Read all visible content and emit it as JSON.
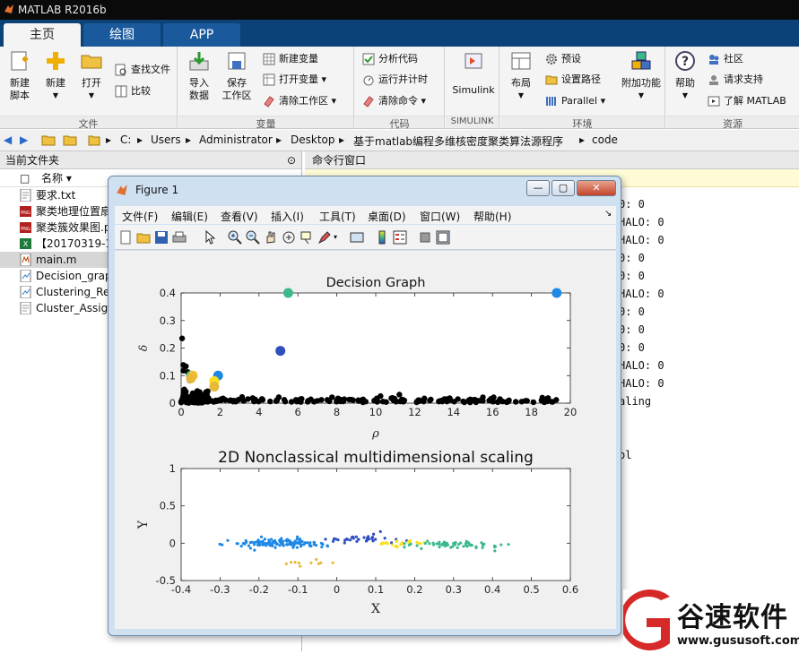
{
  "window": {
    "title": "MATLAB R2016b"
  },
  "tabs": [
    {
      "label": "主页",
      "active": true
    },
    {
      "label": "绘图",
      "active": false
    },
    {
      "label": "APP",
      "active": false
    }
  ],
  "ribbon": {
    "groups": {
      "file": "文件",
      "variable": "变量",
      "code": "代码",
      "simulink": "SIMULINK",
      "env": "环境",
      "resource": "资源"
    },
    "new_script": [
      "新建",
      "脚本"
    ],
    "new": "新建",
    "open": "打开",
    "find_files": "查找文件",
    "compare": "比较",
    "import_data": [
      "导入",
      "数据"
    ],
    "save_ws": [
      "保存",
      "工作区"
    ],
    "new_var": "新建变量",
    "open_var": "打开变量",
    "clear_ws": "清除工作区",
    "analyze": "分析代码",
    "run_time": "运行并计时",
    "clear_cmd": "清除命令",
    "simulink": "Simulink",
    "layout": "布局",
    "prefs": "预设",
    "set_path": "设置路径",
    "parallel": "Parallel",
    "addons": "附加功能",
    "help": "帮助",
    "community": "社区",
    "support": "请求支持",
    "learn": "了解 MATLAB"
  },
  "address": [
    "C:",
    "Users",
    "Administrator",
    "Desktop",
    "基于matlab编程多维核密度聚类算法源程序",
    "code"
  ],
  "left_pane": {
    "title": "当前文件夹",
    "col_name": "名称",
    "files": [
      {
        "name": "要求.txt",
        "icon": "txt-file-icon",
        "selected": false
      },
      {
        "name": "聚类地理位置扇",
        "icon": "png-file-icon",
        "selected": false
      },
      {
        "name": "聚类簇效果图.p",
        "icon": "png-file-icon",
        "selected": false
      },
      {
        "name": "【20170319-1",
        "icon": "excel-file-icon",
        "selected": false
      },
      {
        "name": "main.m",
        "icon": "m-file-icon",
        "selected": true
      },
      {
        "name": "Decision_grap",
        "icon": "fig-file-icon",
        "selected": false
      },
      {
        "name": "Clustering_Re",
        "icon": "fig-file-icon",
        "selected": false
      },
      {
        "name": "Cluster_Assigr",
        "icon": "txt-file-icon",
        "selected": false
      }
    ]
  },
  "command_window": {
    "title": "命令行窗口",
    "lines": [
      "0: 0",
      "HALO: 0",
      "HALO: 0",
      "0: 0",
      "0: 0",
      "HALO: 0",
      "0: 0",
      "0: 0",
      "0: 0",
      "HALO: 0",
      "HALO: 0",
      "aling",
      "",
      "",
      "ol"
    ]
  },
  "figure": {
    "title": "Figure 1",
    "menu": [
      "文件(F)",
      "编辑(E)",
      "查看(V)",
      "插入(I)",
      "工具(T)",
      "桌面(D)",
      "窗口(W)",
      "帮助(H)"
    ]
  },
  "chart_data": [
    {
      "type": "scatter",
      "title": "Decision Graph",
      "xlabel": "ρ",
      "ylabel": "δ",
      "xlim": [
        0,
        20
      ],
      "ylim": [
        0,
        0.4
      ],
      "xticks": [
        0,
        2,
        4,
        6,
        8,
        10,
        12,
        14,
        16,
        18,
        20
      ],
      "yticks": [
        0,
        0.1,
        0.2,
        0.3,
        0.4
      ],
      "highlighted": [
        {
          "x": 5.5,
          "y": 0.4,
          "color": "#3cb98a"
        },
        {
          "x": 19.3,
          "y": 0.4,
          "color": "#1e88e5"
        },
        {
          "x": 5.1,
          "y": 0.19,
          "color": "#2f4fbf"
        },
        {
          "x": 1.9,
          "y": 0.1,
          "color": "#1e88e5"
        },
        {
          "x": 0.5,
          "y": 0.1,
          "color": "#3cb98a"
        },
        {
          "x": 0.6,
          "y": 0.1,
          "color": "#f0c030"
        },
        {
          "x": 0.5,
          "y": 0.09,
          "color": "#e8b83a"
        },
        {
          "x": 1.7,
          "y": 0.08,
          "color": "#f8e020"
        },
        {
          "x": 1.7,
          "y": 0.06,
          "color": "#e8b83a"
        }
      ],
      "point_color": "#000000"
    },
    {
      "type": "scatter",
      "title": "2D Nonclassical multidimensional scaling",
      "xlabel": "X",
      "ylabel": "Y",
      "xlim": [
        -0.4,
        0.6
      ],
      "ylim": [
        -0.5,
        1
      ],
      "xticks": [
        -0.4,
        -0.3,
        -0.2,
        -0.1,
        0,
        0.1,
        0.2,
        0.3,
        0.4,
        0.5,
        0.6
      ],
      "yticks": [
        -0.5,
        0,
        0.5,
        1
      ],
      "clusters": [
        {
          "color": "#1e88e5",
          "cx": -0.15,
          "cy": 0.0,
          "sx": 0.06,
          "sy": 0.06,
          "n": 120
        },
        {
          "color": "#2f4fbf",
          "cx": 0.06,
          "cy": 0.05,
          "sx": 0.05,
          "sy": 0.07,
          "n": 35
        },
        {
          "color": "#f8e020",
          "cx": 0.16,
          "cy": 0.0,
          "sx": 0.04,
          "sy": 0.04,
          "n": 25
        },
        {
          "color": "#3cb98a",
          "cx": 0.3,
          "cy": -0.02,
          "sx": 0.07,
          "sy": 0.05,
          "n": 60
        },
        {
          "color": "#e8b83a",
          "cx": -0.1,
          "cy": -0.25,
          "sx": 0.06,
          "sy": 0.06,
          "n": 10
        }
      ]
    }
  ],
  "watermark": {
    "text": "谷速软件",
    "url": "www.gususoft.com"
  }
}
